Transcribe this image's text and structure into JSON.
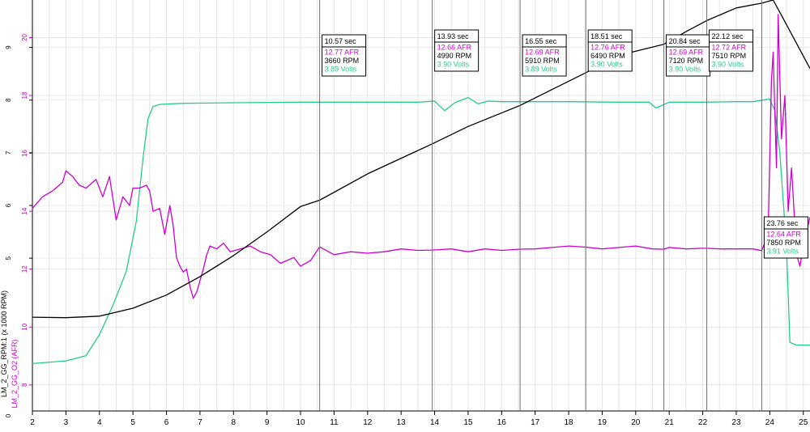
{
  "chart_data": {
    "type": "line",
    "xlim": [
      2,
      25.2
    ],
    "x_ticks": [
      2,
      3,
      4,
      5,
      6,
      7,
      8,
      9,
      10,
      11,
      12,
      13,
      14,
      15,
      16,
      17,
      18,
      19,
      20,
      21,
      22,
      23,
      24,
      25
    ],
    "left_axis_rpm": {
      "label": "LM_2_GG_RPM:1 (x 1000 RPM)",
      "ticks": [
        5,
        6,
        7,
        8,
        9
      ],
      "ylim": [
        2.1,
        9.9
      ]
    },
    "left_axis_afr": {
      "label": "LM_2_GG_O2 (AFR)",
      "ticks": [
        8,
        10,
        12,
        14,
        16,
        18,
        20
      ],
      "ylim": [
        7.1,
        21.3
      ]
    },
    "axis_zero_label": "0",
    "grid": true,
    "colors": {
      "rpm": "#000000",
      "afr": "#cc00cc",
      "volts": "#22cc88",
      "cursor": "#707070"
    },
    "series": [
      {
        "key": "volts",
        "axis": "rpm",
        "x": [
          2.0,
          3.0,
          3.6,
          4.0,
          4.4,
          4.8,
          5.1,
          5.3,
          5.45,
          5.6,
          5.8,
          6.5,
          8,
          10,
          12,
          13.5,
          14,
          14.3,
          14.6,
          15,
          15.3,
          15.6,
          16,
          17,
          18,
          19.5,
          20.4,
          20.6,
          21,
          22,
          23,
          23.5,
          23.8,
          24.0,
          24.15,
          24.3,
          24.5,
          24.6,
          24.8,
          25.2
        ],
        "y": [
          3.0,
          3.05,
          3.15,
          3.55,
          4.1,
          4.75,
          5.7,
          6.9,
          7.65,
          7.88,
          7.92,
          7.94,
          7.95,
          7.96,
          7.96,
          7.96,
          7.98,
          7.8,
          7.95,
          8.05,
          7.93,
          7.98,
          7.97,
          7.97,
          7.97,
          7.96,
          7.96,
          7.85,
          7.96,
          7.96,
          7.97,
          7.97,
          8.0,
          8.02,
          7.8,
          7.0,
          5.2,
          3.4,
          3.35,
          3.35
        ]
      },
      {
        "key": "afr",
        "axis": "afr",
        "x": [
          2.0,
          2.3,
          2.6,
          2.9,
          3.0,
          3.2,
          3.4,
          3.6,
          3.9,
          4.1,
          4.3,
          4.5,
          4.7,
          4.9,
          5.0,
          5.2,
          5.4,
          5.5,
          5.6,
          5.8,
          5.95,
          6.1,
          6.2,
          6.3,
          6.4,
          6.5,
          6.6,
          6.7,
          6.8,
          6.9,
          7.0,
          7.1,
          7.2,
          7.3,
          7.5,
          7.7,
          7.9,
          8.2,
          8.5,
          8.8,
          9.1,
          9.4,
          9.8,
          10.0,
          10.3,
          10.57,
          11,
          11.5,
          12,
          12.5,
          13,
          13.5,
          13.93,
          14.5,
          15,
          15.5,
          16,
          16.55,
          17,
          17.5,
          18,
          18.51,
          19,
          19.5,
          20,
          20.5,
          20.84,
          21,
          21.5,
          22,
          22.12,
          22.5,
          23,
          23.5,
          23.76,
          23.95,
          24.05,
          24.1,
          24.2,
          24.25,
          24.35,
          24.45,
          24.55,
          24.65,
          24.8,
          24.9,
          25.0,
          25.2
        ],
        "y": [
          14.1,
          14.5,
          14.7,
          15.0,
          15.4,
          15.2,
          14.9,
          14.8,
          15.1,
          14.5,
          15.2,
          13.7,
          14.5,
          14.2,
          14.8,
          14.8,
          14.9,
          14.7,
          14.0,
          14.1,
          13.2,
          14.2,
          13.5,
          12.4,
          12.1,
          11.9,
          12.0,
          11.4,
          11.0,
          11.2,
          11.6,
          12.0,
          12.5,
          12.8,
          12.7,
          12.9,
          12.6,
          12.7,
          12.8,
          12.6,
          12.5,
          12.2,
          12.4,
          12.1,
          12.3,
          12.77,
          12.5,
          12.6,
          12.55,
          12.6,
          12.7,
          12.65,
          12.66,
          12.7,
          12.6,
          12.7,
          12.65,
          12.69,
          12.7,
          12.75,
          12.8,
          12.76,
          12.7,
          12.75,
          12.8,
          12.7,
          12.69,
          12.75,
          12.7,
          12.72,
          12.72,
          12.7,
          12.7,
          12.7,
          12.64,
          13.2,
          18.5,
          19.5,
          15.5,
          20.8,
          16.5,
          18.0,
          14.0,
          15.5,
          12.5,
          12.1,
          12.8,
          13.8
        ]
      },
      {
        "key": "rpm",
        "axis": "rpm",
        "x": [
          2.0,
          3.0,
          4.0,
          5.0,
          6.0,
          7.0,
          8.0,
          9.0,
          10.0,
          10.57,
          12.0,
          13.93,
          15.0,
          16.55,
          17.5,
          18.51,
          19.5,
          20.84,
          21.5,
          22.12,
          23.0,
          23.76,
          24.1,
          24.4,
          25.2
        ],
        "y": [
          3.88,
          3.87,
          3.9,
          4.05,
          4.3,
          4.65,
          5.05,
          5.5,
          5.98,
          6.1,
          6.6,
          7.17,
          7.5,
          7.9,
          8.2,
          8.52,
          8.85,
          9.06,
          9.3,
          9.51,
          9.75,
          9.84,
          9.9,
          9.55,
          8.6
        ]
      }
    ],
    "cursors": [
      {
        "x": 10.57,
        "time": "10.57 sec",
        "afr": "12.77 AFR",
        "rpm": "3660 RPM",
        "volts": "3.89 Volts"
      },
      {
        "x": 13.93,
        "time": "13.93 sec",
        "afr": "12.66 AFR",
        "rpm": "4990 RPM",
        "volts": "3.90 Volts"
      },
      {
        "x": 16.55,
        "time": "16.55 sec",
        "afr": "12.69 AFR",
        "rpm": "5910 RPM",
        "volts": "3.89 Volts"
      },
      {
        "x": 18.51,
        "time": "18.51 sec",
        "afr": "12.76 AFR",
        "rpm": "6490 RPM",
        "volts": "3.90 Volts"
      },
      {
        "x": 20.84,
        "time": "20.84 sec",
        "afr": "12.69 AFR",
        "rpm": "7120 RPM",
        "volts": "3.90 Volts"
      },
      {
        "x": 22.12,
        "time": "22.12 sec",
        "afr": "12.72 AFR",
        "rpm": "7510 RPM",
        "volts": "3.90 Volts"
      },
      {
        "x": 23.76,
        "time": "23.76 sec",
        "afr": "12.64 AFR",
        "rpm": "7850 RPM",
        "volts": "3.91 Volts"
      }
    ]
  }
}
